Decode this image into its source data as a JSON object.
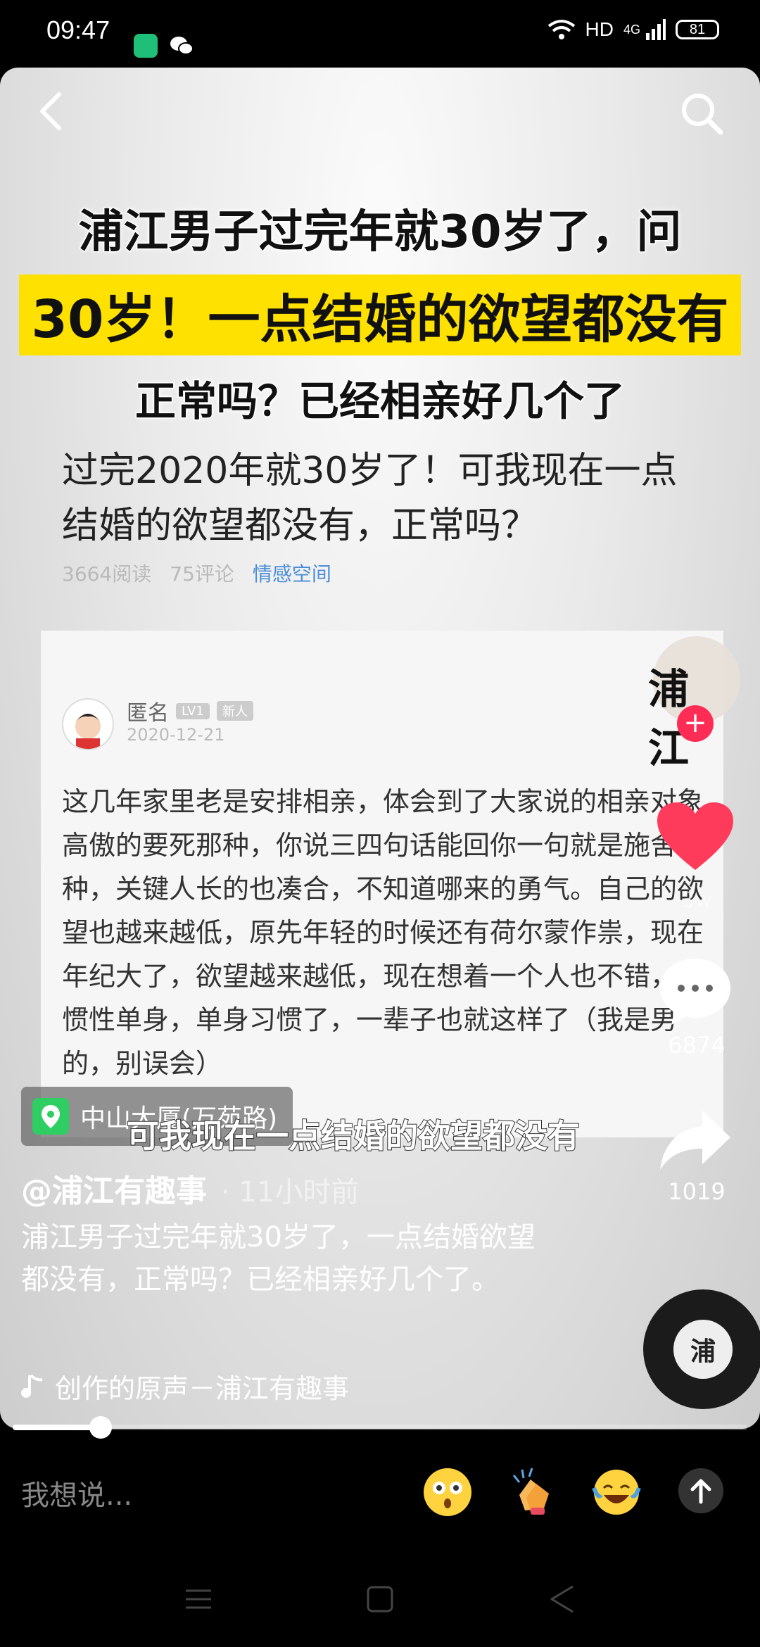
{
  "status_bar": {
    "time": "09:47",
    "network": "HD",
    "signal": "4G",
    "battery": "81"
  },
  "headline": {
    "line1": "浦江男子过完年就30岁了，问",
    "line2": "30岁！一点结婚的欲望都没有",
    "line3": "正常吗？已经相亲好几个了"
  },
  "post": {
    "title": "过完2020年就30岁了！可我现在一点结婚的欲望都没有，正常吗？",
    "reads": "3664阅读",
    "comments": "75评论",
    "tag": "情感空间",
    "author": "匿名",
    "level": "LV1",
    "badge": "新人",
    "date": "2020-12-21",
    "body": "这几年家里老是安排相亲，体会到了大家说的相亲对象高傲的要死那种，你说三四句话能回你一句就是施舍那种，关键人长的也凑合，不知道哪来的勇气。自己的欲望也越来越低，原先年轻的时候还有荷尔蒙作祟，现在年纪大了，欲望越来越低，现在想着一个人也不错，习惯性单身，单身习惯了，一辈子也就这样了（我是男的，别误会）"
  },
  "location": "中山大厦(万苑路)",
  "subtitle": "可我现在一点结婚的欲望都没有",
  "account": {
    "handle": "@浦江有趣事",
    "ago": "· 11小时前"
  },
  "description": "浦江男子过完年就30岁了，一点结婚欲望都没有，正常吗？已经相亲好几个了。",
  "music": "创作的原声－浦江有趣事",
  "actions": {
    "follow_avatar_text": "浦 江",
    "likes": "3w",
    "comments": "6874",
    "shares": "1019"
  },
  "progress": 0.12,
  "comment_bar": {
    "placeholder": "我想说..."
  },
  "icons": [
    "back-icon",
    "search-icon",
    "location-pin-icon",
    "music-note-icon",
    "heart-icon",
    "comment-icon",
    "share-icon",
    "send-icon",
    "menu-icon",
    "home-icon",
    "back-triangle-icon"
  ]
}
